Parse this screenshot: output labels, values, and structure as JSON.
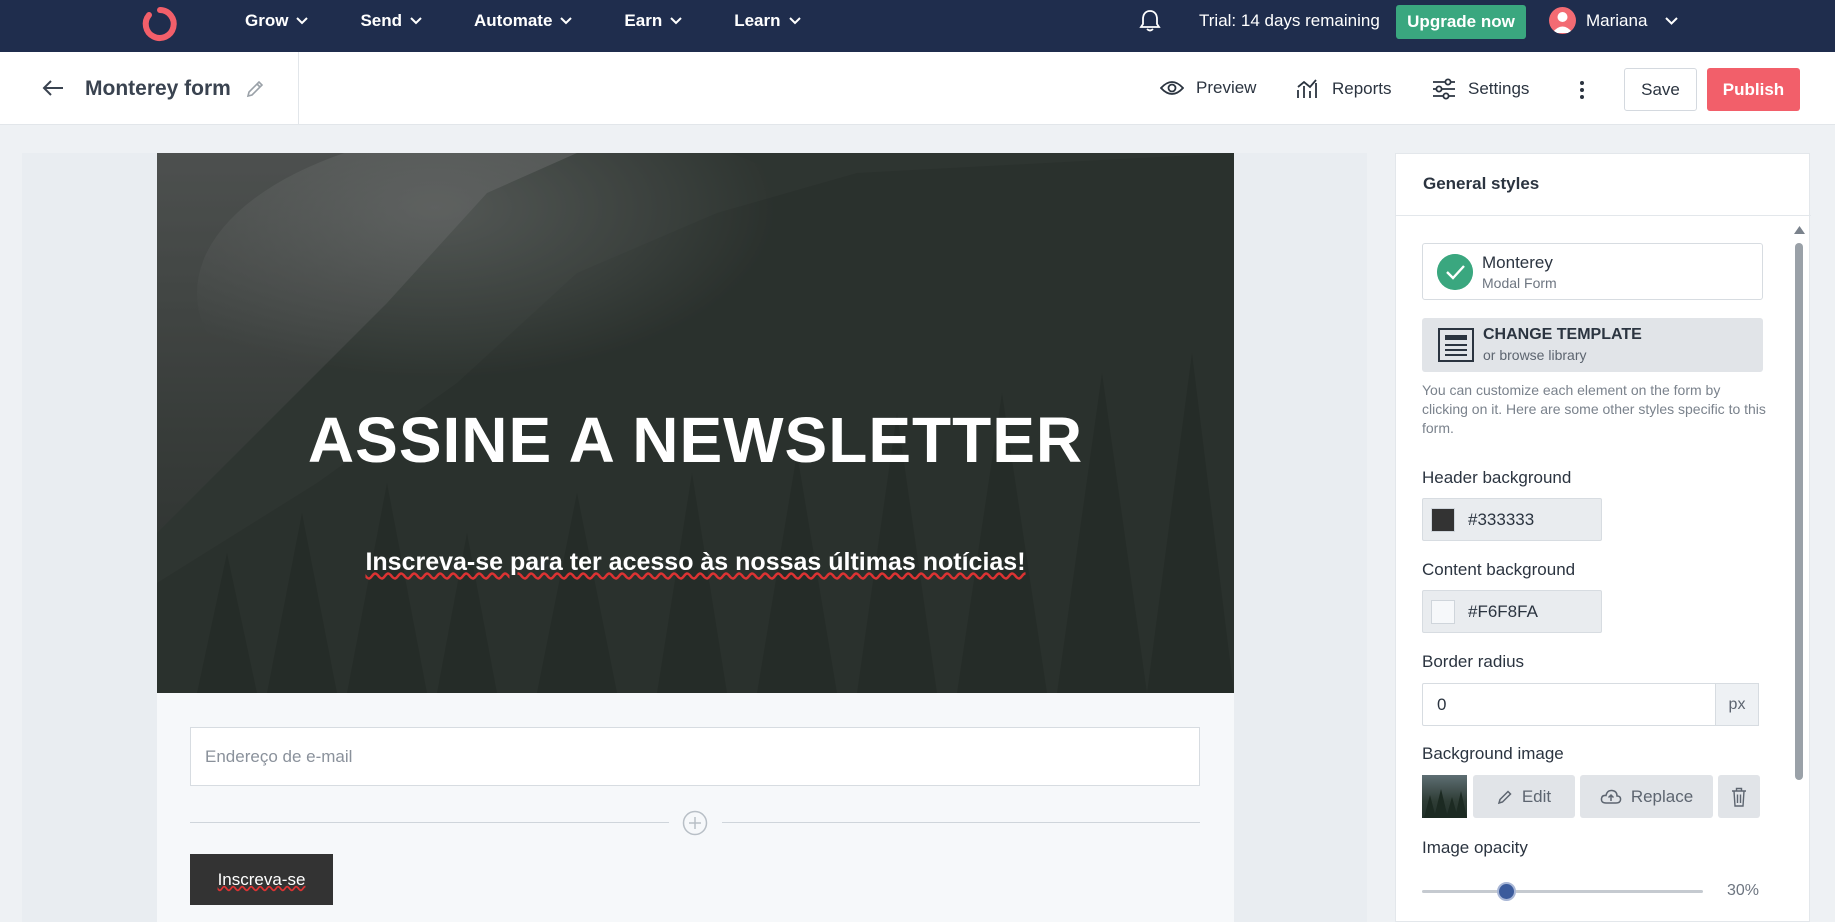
{
  "nav": {
    "items": [
      {
        "label": "Grow"
      },
      {
        "label": "Send"
      },
      {
        "label": "Automate"
      },
      {
        "label": "Earn"
      },
      {
        "label": "Learn"
      }
    ],
    "trial_text": "Trial: 14 days remaining",
    "upgrade_label": "Upgrade now",
    "username": "Mariana",
    "colors": {
      "bar": "#1f2d4d",
      "upgrade": "#3aa77f",
      "logo": "#f25f6a"
    }
  },
  "editor": {
    "form_title": "Monterey form",
    "preview_label": "Preview",
    "reports_label": "Reports",
    "settings_label": "Settings",
    "save_label": "Save",
    "publish_label": "Publish",
    "colors": {
      "publish": "#f25f6a"
    }
  },
  "form_preview": {
    "heading": "ASSINE A NEWSLETTER",
    "subheading": "Inscreva-se para ter acesso às nossas últimas notícias!",
    "email_placeholder": "Endereço de e-mail",
    "button_label": "Inscreva-se"
  },
  "panel": {
    "title": "General styles",
    "template": {
      "name": "Monterey",
      "type": "Modal Form"
    },
    "change_template": {
      "title": "CHANGE TEMPLATE",
      "subtitle": "or browse library"
    },
    "help_text": "You can customize each element on the form by clicking on it. Here are some other styles specific to this form.",
    "header_background": {
      "label": "Header background",
      "value": "#333333"
    },
    "content_background": {
      "label": "Content background",
      "value": "#F6F8FA"
    },
    "border_radius": {
      "label": "Border radius",
      "value": "0",
      "unit": "px"
    },
    "background_image": {
      "label": "Background image",
      "edit_label": "Edit",
      "replace_label": "Replace"
    },
    "image_opacity": {
      "label": "Image opacity",
      "value_text": "30%",
      "value": 0.3
    }
  }
}
